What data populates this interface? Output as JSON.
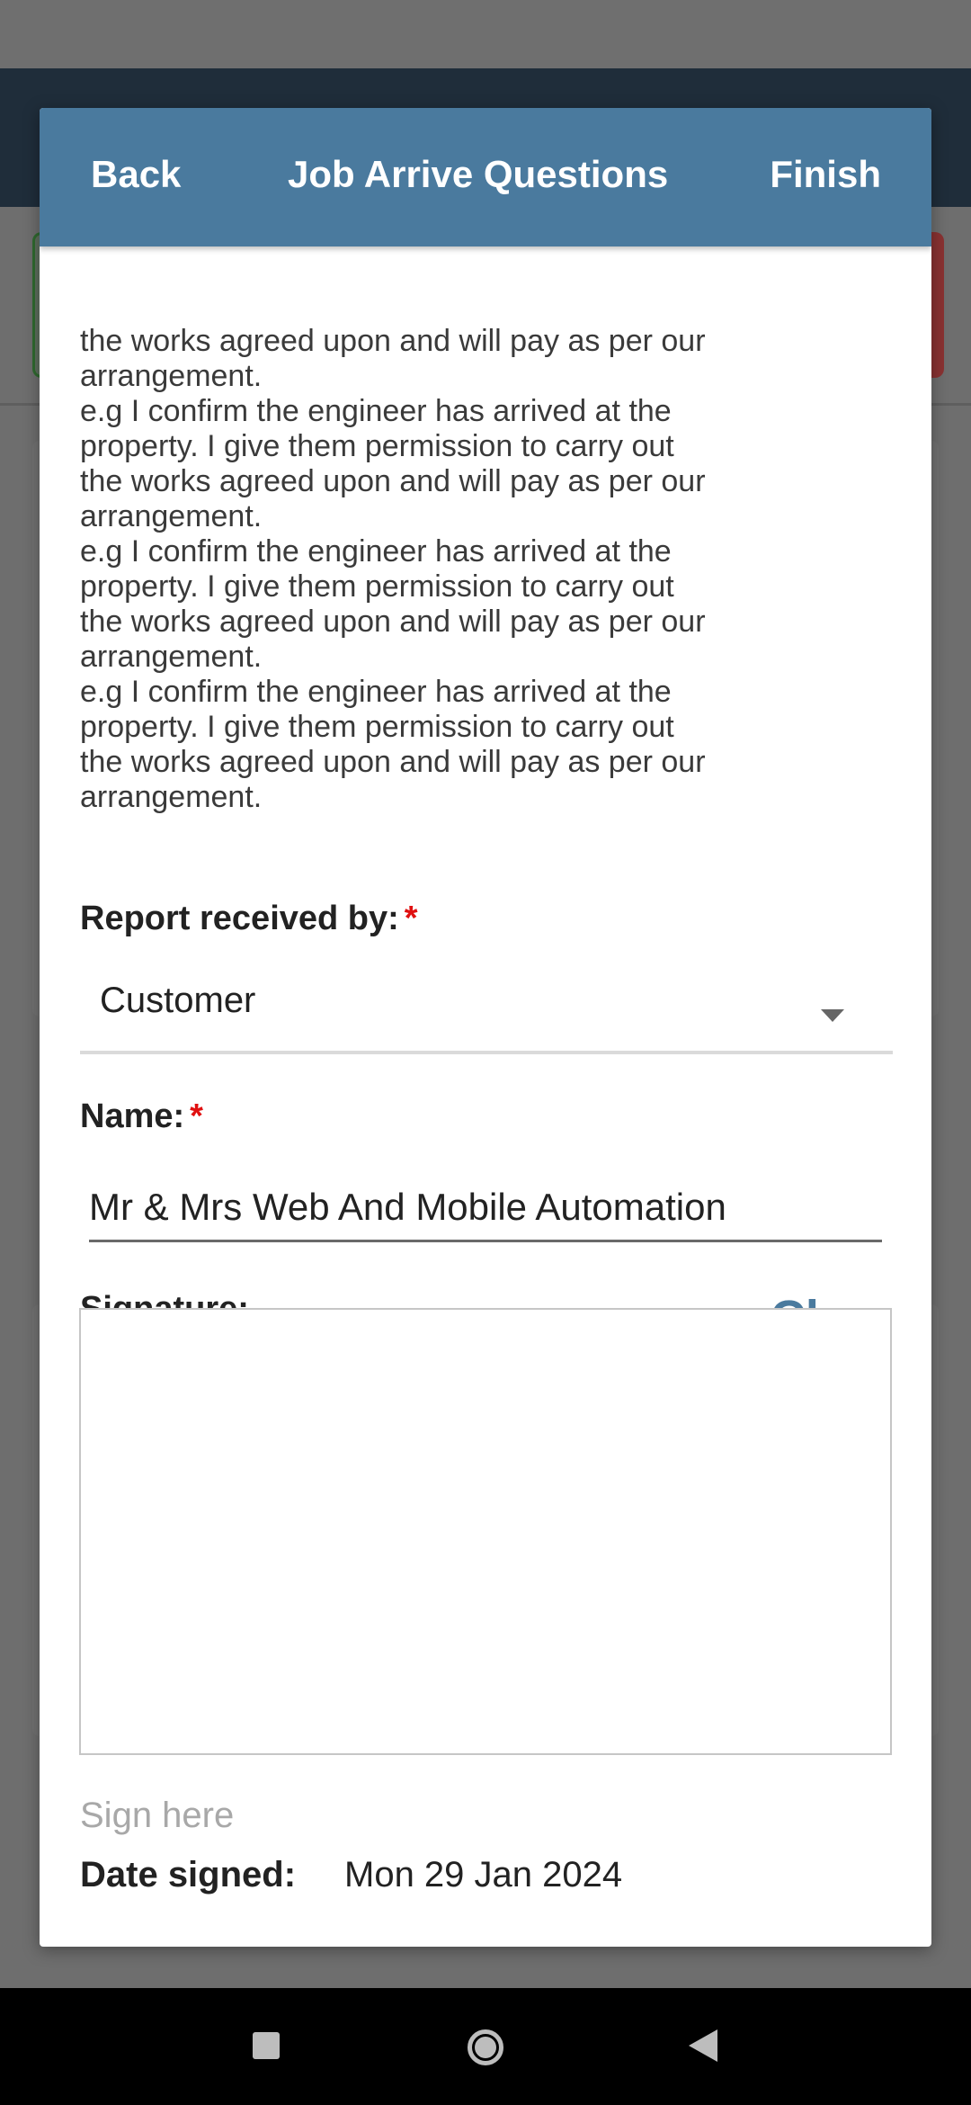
{
  "dialog": {
    "back_label": "Back",
    "title": "Job Arrive Questions",
    "finish_label": "Finish"
  },
  "terms_text": "the works agreed upon and will pay as per our\narrangement.\ne.g I confirm the engineer has arrived at the\nproperty. I give them permission to carry out\nthe works agreed upon and will pay as per our\narrangement.\ne.g I confirm the engineer has arrived at the\nproperty. I give them permission to carry out\nthe works agreed upon and will pay as per our\narrangement.\ne.g I confirm the engineer has arrived at the\nproperty. I give them permission to carry out\nthe works agreed upon and will pay as per our\narrangement.",
  "report_received": {
    "label": "Report received by:",
    "required_mark": "*",
    "selected": "Customer"
  },
  "name_field": {
    "label": "Name:",
    "required_mark": "*",
    "value": "Mr & Mrs Web And Mobile Automation"
  },
  "signature": {
    "label": "Signature:",
    "clear_label": "Clear",
    "hint": "Sign here"
  },
  "date_signed": {
    "label": "Date signed:",
    "value": "Mon 29 Jan 2024"
  },
  "colors": {
    "header_blue": "#4a7a9e",
    "required_red": "#e01010",
    "appbar_dark": "#1f2d3a"
  },
  "icons": {
    "nav_recents": "square-icon",
    "nav_home": "home-circle-icon",
    "nav_back": "back-triangle-icon",
    "select_caret": "caret-down-icon"
  }
}
